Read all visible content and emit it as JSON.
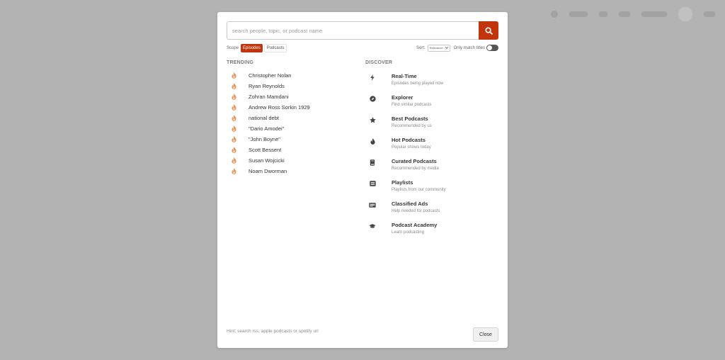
{
  "background_nav": {
    "items": [
      "Add feed",
      "API",
      "Help",
      "Browse ▾",
      "Login"
    ]
  },
  "search": {
    "placeholder": "search people, topic, or podcast name",
    "button_icon": "search-icon"
  },
  "scope": {
    "label": "Scope",
    "options": [
      "Episodes",
      "Podcasts"
    ],
    "active": "Episodes"
  },
  "sort": {
    "label": "Sort:",
    "selected": "Relevance"
  },
  "match_toggle": {
    "label": "Only match titles",
    "on": false
  },
  "trending": {
    "heading": "TRENDING",
    "items": [
      "Christopher Nolan",
      "Ryan Reynolds",
      "Zohran Mamdani",
      "Andrew Ross Sorkin 1929",
      "national debt",
      "\"Dario Amodei\"",
      "\"John Boyne\"",
      "Scott Bessent",
      "Susan Wojcicki",
      "Noam Dworman"
    ]
  },
  "discover": {
    "heading": "DISCOVER",
    "items": [
      {
        "title": "Real-Time",
        "subtitle": "Episodes being played now",
        "icon": "bolt-icon"
      },
      {
        "title": "Explorer",
        "subtitle": "Find similar podcasts",
        "icon": "compass-icon"
      },
      {
        "title": "Best Podcasts",
        "subtitle": "Recommended by us",
        "icon": "star-icon"
      },
      {
        "title": "Hot Podcasts",
        "subtitle": "Popular shows today",
        "icon": "flame-icon"
      },
      {
        "title": "Curated Podcasts",
        "subtitle": "Recommended by media",
        "icon": "book-icon"
      },
      {
        "title": "Playlists",
        "subtitle": "Playlists from our community",
        "icon": "list-icon"
      },
      {
        "title": "Classified Ads",
        "subtitle": "Help needed for podcasts",
        "icon": "ad-icon"
      },
      {
        "title": "Podcast Academy",
        "subtitle": "Learn podcasting",
        "icon": "graduation-cap-icon"
      }
    ]
  },
  "footer": {
    "hint": "Hint: search rss, apple podcasts or spotify url",
    "close_label": "Close"
  },
  "colors": {
    "accent": "#c0350d",
    "fire_icon": "#e8935a",
    "overlay": "#b3b3b3"
  }
}
